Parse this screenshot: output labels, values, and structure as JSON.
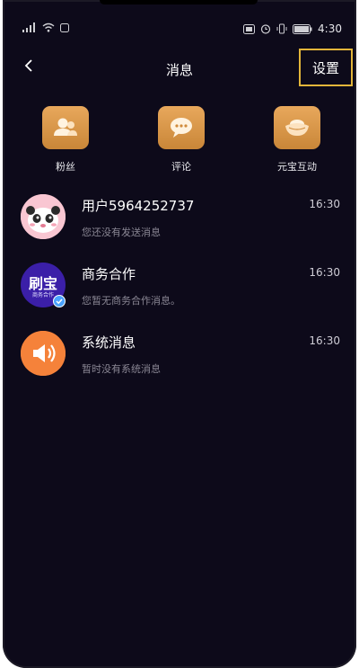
{
  "status_bar": {
    "time": "4:30"
  },
  "header": {
    "title": "消息",
    "settings_label": "设置"
  },
  "quick_actions": [
    {
      "label": "粉丝",
      "icon": "fans-icon"
    },
    {
      "label": "评论",
      "icon": "comment-icon"
    },
    {
      "label": "元宝互动",
      "icon": "ingot-icon"
    }
  ],
  "messages": [
    {
      "name": "用户5964252737",
      "preview": "您还没有发送消息",
      "time": "16:30",
      "avatar": "panda-avatar"
    },
    {
      "name": "商务合作",
      "preview": "您暂无商务合作消息。",
      "time": "16:30",
      "avatar": "shuabao-avatar",
      "avatar_text": "刷宝",
      "avatar_sub": "商务合作"
    },
    {
      "name": "系统消息",
      "preview": "暂时没有系统消息",
      "time": "16:30",
      "avatar": "speaker-avatar"
    }
  ],
  "colors": {
    "background": "#0d0a1a",
    "accent_gold": "#d6963f",
    "highlight_border": "#e2b53a",
    "speaker_orange": "#f5823a",
    "brand_purple": "#3b1fa8"
  }
}
